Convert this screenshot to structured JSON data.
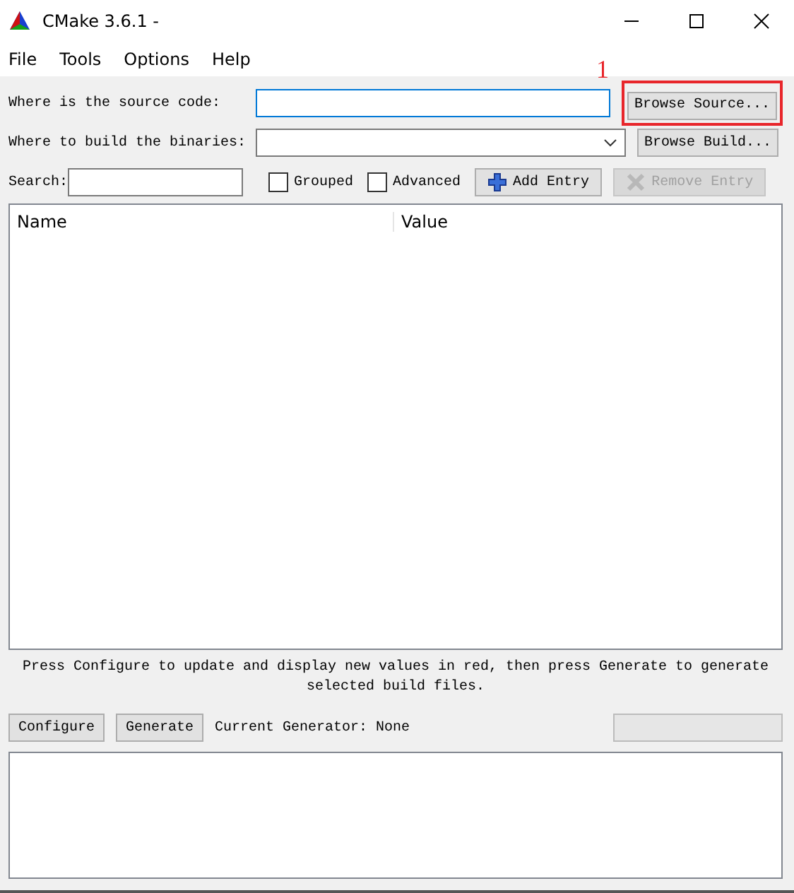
{
  "window": {
    "title": "CMake 3.6.1 -"
  },
  "menu": [
    "File",
    "Tools",
    "Options",
    "Help"
  ],
  "source": {
    "label": "Where is the source code:",
    "button": "Browse Source...",
    "highlighted": true,
    "annotation": "1"
  },
  "build": {
    "label": "Where to build the binaries:",
    "button": "Browse Build..."
  },
  "search": {
    "label": "Search:"
  },
  "checkboxes": [
    {
      "label": "Grouped",
      "checked": false
    },
    {
      "label": "Advanced",
      "checked": false
    }
  ],
  "add_entry": {
    "label": "Add Entry",
    "disabled": false
  },
  "remove_entry": {
    "label": "Remove Entry",
    "disabled": true
  },
  "table": {
    "columns": [
      "Name",
      "Value"
    ]
  },
  "message": "Press Configure to update and display new values in red, then press Generate to generate selected build files.",
  "actions": [
    "Configure",
    "Generate"
  ],
  "generator": "Current Generator: None"
}
